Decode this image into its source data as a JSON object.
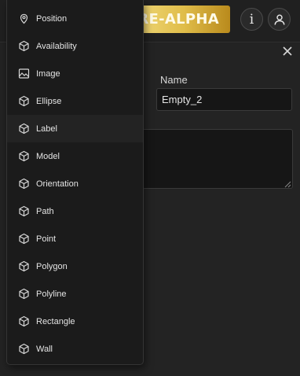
{
  "header": {
    "badge_text": "RE-ALPHA",
    "info_button_glyph": "i",
    "info_icon": "info-icon",
    "user_icon": "user-icon",
    "badge_colors": [
      "#f2dc7f",
      "#b98a1c"
    ]
  },
  "panel": {
    "close_icon": "close-icon",
    "name_label": "Name",
    "name_value": "Empty_2",
    "description_value": ""
  },
  "menu": {
    "highlighted_index": 4,
    "items": [
      {
        "label": "Position",
        "icon": "map-pin-icon"
      },
      {
        "label": "Availability",
        "icon": "cube-icon"
      },
      {
        "label": "Image",
        "icon": "image-icon"
      },
      {
        "label": "Ellipse",
        "icon": "cube-icon"
      },
      {
        "label": "Label",
        "icon": "cube-icon"
      },
      {
        "label": "Model",
        "icon": "cube-icon"
      },
      {
        "label": "Orientation",
        "icon": "cube-icon"
      },
      {
        "label": "Path",
        "icon": "cube-icon"
      },
      {
        "label": "Point",
        "icon": "cube-icon"
      },
      {
        "label": "Polygon",
        "icon": "cube-icon"
      },
      {
        "label": "Polyline",
        "icon": "cube-icon"
      },
      {
        "label": "Rectangle",
        "icon": "cube-icon"
      },
      {
        "label": "Wall",
        "icon": "cube-icon"
      }
    ]
  }
}
